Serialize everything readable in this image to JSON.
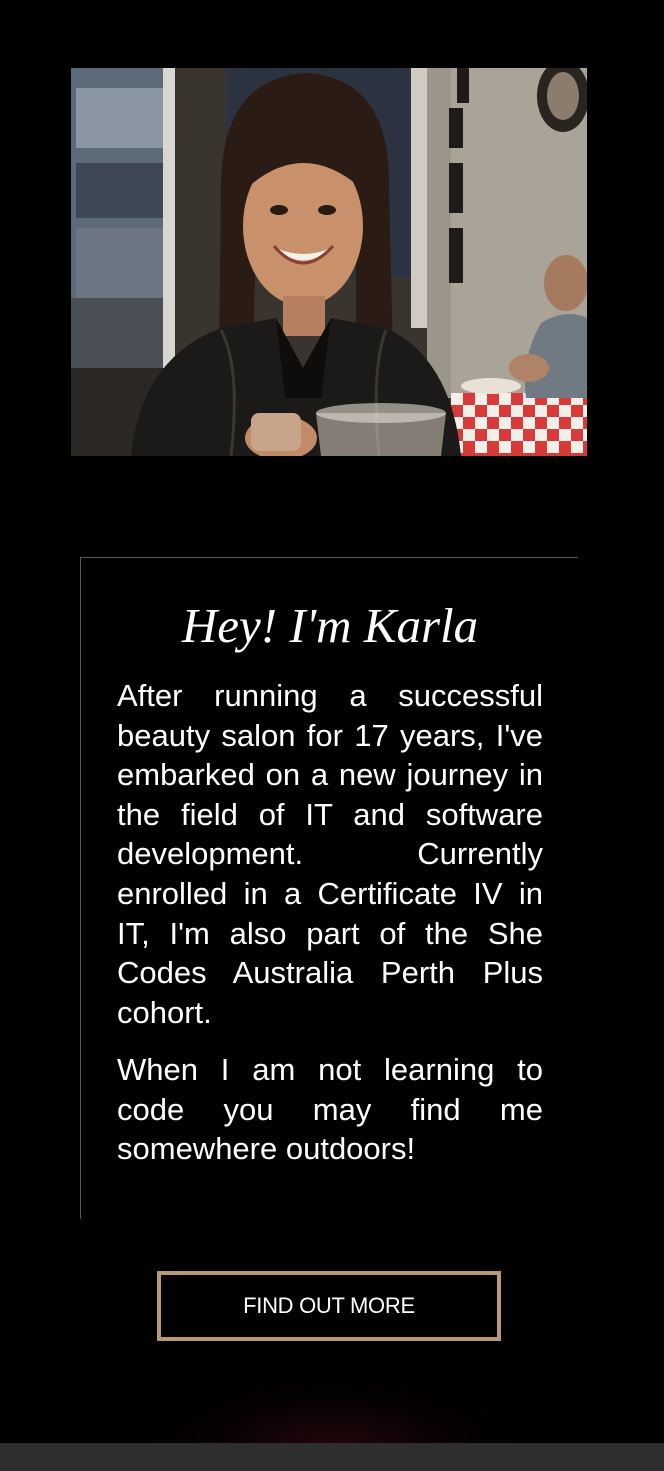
{
  "profile": {
    "photo_alt": "Karla smiling at a restaurant table"
  },
  "about": {
    "title": "Hey! I'm Karla",
    "paragraph_1": "After running a successful beauty salon for 17 years, I've embarked on a new journey in the field of IT and software development. Currently enrolled in a Certificate IV in IT, I'm also part of the She Codes Australia Perth Plus cohort.",
    "paragraph_2": "When I am not learning to code you may find me somewhere outdoors!"
  },
  "cta": {
    "label": "FIND OUT MORE"
  },
  "colors": {
    "background": "#000000",
    "button_border": "#b89a72",
    "card_border": "#5a5a5a",
    "footer_bar": "#2e2e2e"
  }
}
